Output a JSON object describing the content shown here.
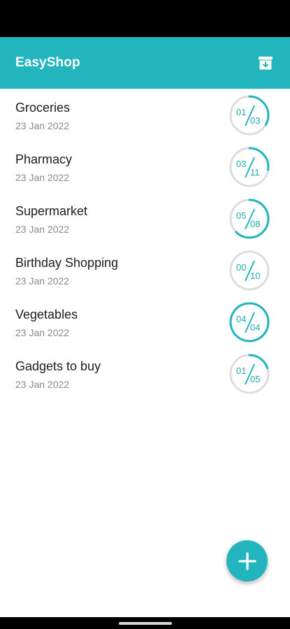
{
  "app": {
    "title": "EasyShop",
    "accent_color": "#23b5bd",
    "archive_icon": "archive-icon",
    "fab_icon": "plus-icon"
  },
  "lists": [
    {
      "name": "Groceries",
      "date": "23 Jan 2022",
      "done": "01",
      "total": "03",
      "progress": 0.3333
    },
    {
      "name": "Pharmacy",
      "date": "23 Jan 2022",
      "done": "03",
      "total": "11",
      "progress": 0.2727
    },
    {
      "name": "Supermarket",
      "date": "23 Jan 2022",
      "done": "05",
      "total": "08",
      "progress": 0.625
    },
    {
      "name": "Birthday Shopping",
      "date": "23 Jan 2022",
      "done": "00",
      "total": "10",
      "progress": 0
    },
    {
      "name": "Vegetables",
      "date": "23 Jan 2022",
      "done": "04",
      "total": "04",
      "progress": 1
    },
    {
      "name": "Gadgets to buy",
      "date": "23 Jan 2022",
      "done": "01",
      "total": "05",
      "progress": 0.2
    }
  ]
}
